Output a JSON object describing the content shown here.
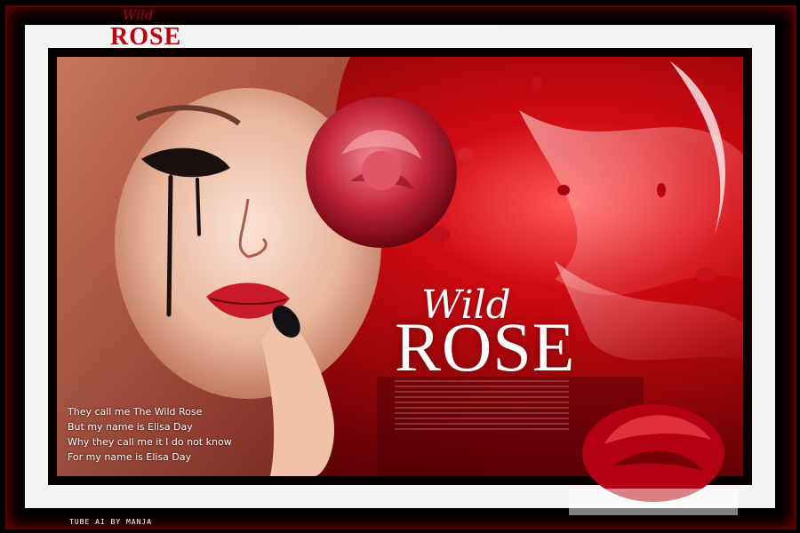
{
  "corner_logo": {
    "script": "Wild",
    "main": "ROSE"
  },
  "title": {
    "script": "Wild",
    "main": "ROSE"
  },
  "lyrics": [
    "They call me The Wild Rose",
    "But my name is Elisa Day",
    "Why they call me it I do not know",
    "For my name is Elisa Day"
  ],
  "credit": "TUBE AI BY MANJA",
  "colors": {
    "frame": "#000000",
    "mat": "#f4f4f4",
    "accent": "#c00012",
    "text": "#ffffff"
  }
}
